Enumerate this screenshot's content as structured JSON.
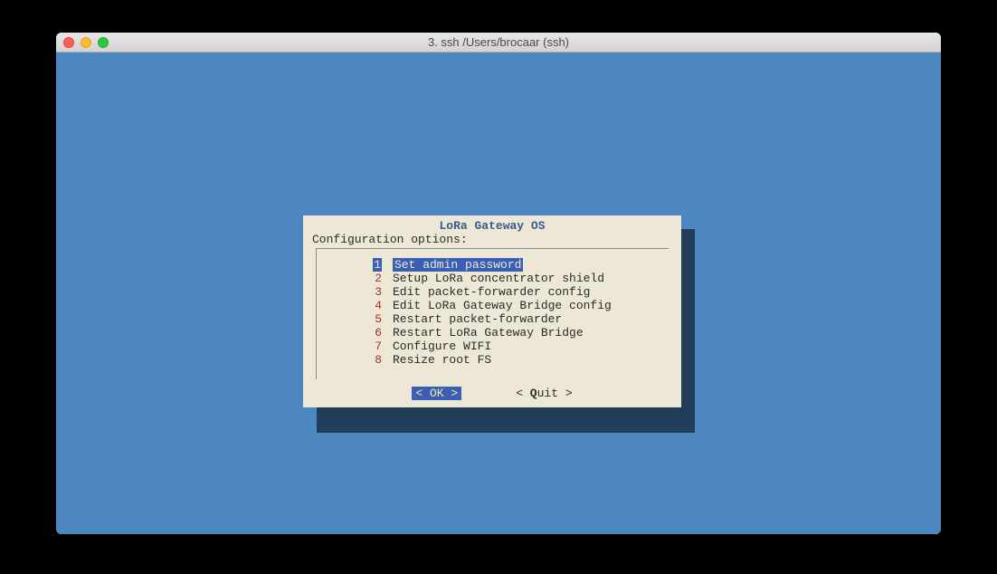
{
  "window": {
    "title": "3. ssh  /Users/brocaar (ssh)"
  },
  "dialog": {
    "title": "LoRa Gateway OS",
    "subtitle": "Configuration options:",
    "items": [
      {
        "num": "1",
        "label": "Set admin password",
        "selected": true
      },
      {
        "num": "2",
        "label": "Setup LoRa concentrator shield",
        "selected": false
      },
      {
        "num": "3",
        "label": "Edit packet-forwarder config",
        "selected": false
      },
      {
        "num": "4",
        "label": "Edit LoRa Gateway Bridge config",
        "selected": false
      },
      {
        "num": "5",
        "label": "Restart packet-forwarder",
        "selected": false
      },
      {
        "num": "6",
        "label": "Restart LoRa Gateway Bridge",
        "selected": false
      },
      {
        "num": "7",
        "label": "Configure WIFI",
        "selected": false
      },
      {
        "num": "8",
        "label": "Resize root FS",
        "selected": false
      }
    ],
    "buttons": {
      "ok": "<  OK  >",
      "quit_prefix": "< ",
      "quit_hot": "Q",
      "quit_rest": "uit >"
    }
  }
}
